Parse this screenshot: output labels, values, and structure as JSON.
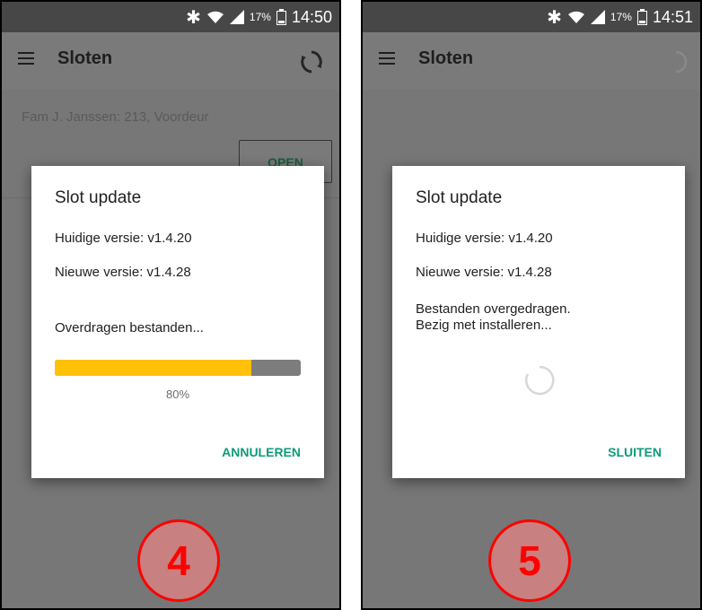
{
  "screens": [
    {
      "status": {
        "battery_pct": "17%",
        "time": "14:50"
      },
      "app_title": "Sloten",
      "lock_name": "Fam J. Janssen: 213, Voordeur",
      "open_label": "OPEN",
      "dialog": {
        "title": "Slot update",
        "current_version": "Huidige versie: v1.4.20",
        "new_version": "Nieuwe versie: v1.4.28",
        "status_text": "Overdragen bestanden...",
        "progress": 0.8,
        "progress_label": "80%",
        "action_label": "ANNULEREN"
      },
      "step": "4"
    },
    {
      "status": {
        "battery_pct": "17%",
        "time": "14:51"
      },
      "app_title": "Sloten",
      "dialog": {
        "title": "Slot update",
        "current_version": "Huidige versie: v1.4.20",
        "new_version": "Nieuwe versie: v1.4.28",
        "status_line1": "Bestanden overgedragen.",
        "status_line2": "Bezig met installeren...",
        "action_label": "SLUITEN"
      },
      "step": "5"
    }
  ],
  "colors": {
    "accent": "#0f9a7a",
    "progress": "#ffc107",
    "step_marker": "#ff0000"
  }
}
